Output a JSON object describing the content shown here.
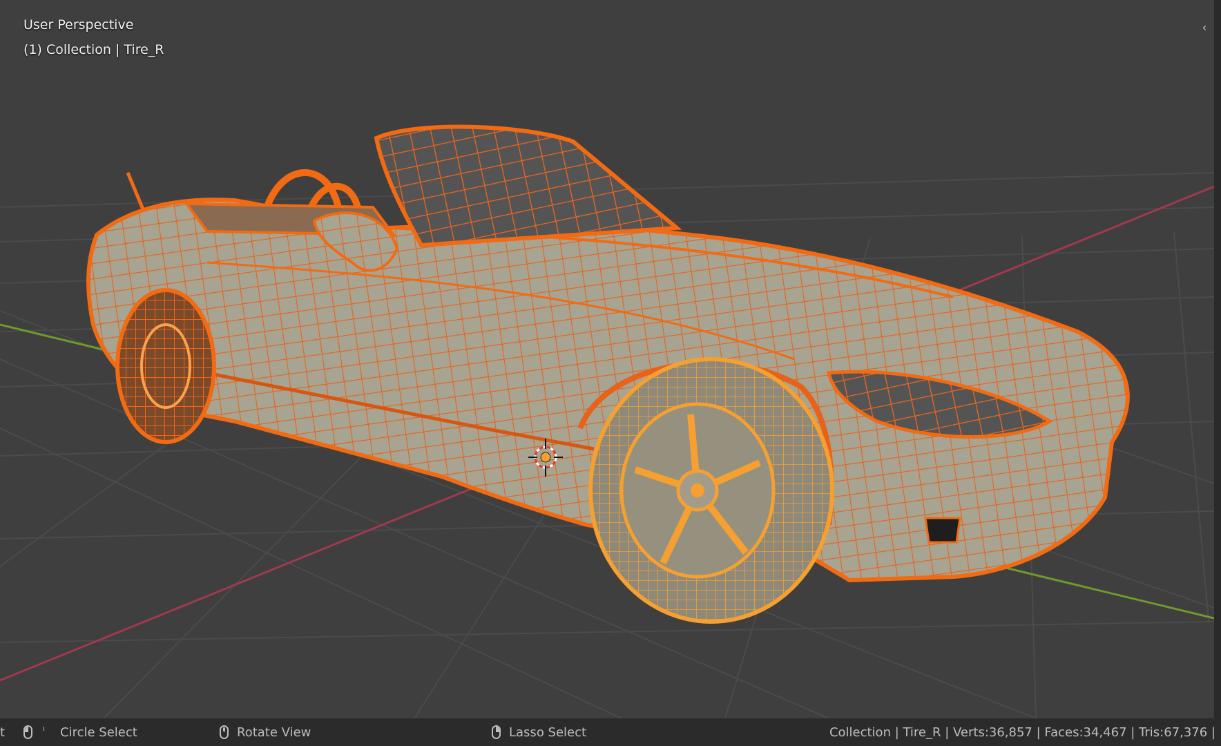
{
  "viewport": {
    "view_name": "User Perspective",
    "active_object": "(1) Collection | Tire_R",
    "toggle_icon": "chevron-left-icon",
    "object_icon": "wireframe-car-mesh",
    "cursor_icon": "3d-cursor-icon",
    "colors": {
      "background": "#3f3f3f",
      "grid": "#4a4a4a",
      "x_axis": "#a0394d",
      "y_axis": "#6f9a2c",
      "selected": "#f26b12",
      "active": "#f5a030",
      "surface": "#a8a492"
    }
  },
  "statusbar": {
    "left_fragment": "t",
    "hints": [
      {
        "icon": "mouse-left-icon",
        "label": "Circle Select"
      },
      {
        "icon": "mouse-middle-icon",
        "label": "Rotate View"
      },
      {
        "icon": "mouse-right-icon",
        "label": "Lasso Select"
      }
    ],
    "stats": "Collection | Tire_R | Verts:36,857 | Faces:34,467 | Tris:67,376 |"
  }
}
